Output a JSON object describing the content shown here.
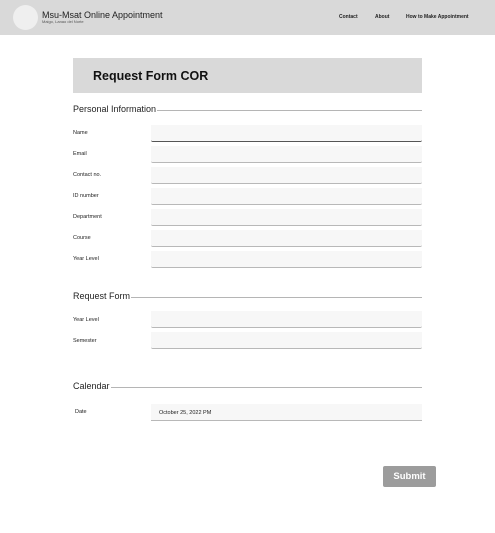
{
  "header": {
    "brand_title": "Msu-Msat Online Appointment",
    "brand_subtitle": "Maigo, Lanao del Norte",
    "logo_icon": "circle-logo",
    "nav": [
      {
        "label": "Contact"
      },
      {
        "label": "About"
      },
      {
        "label": "How to Make Appointment"
      }
    ]
  },
  "form": {
    "title": "Request Form COR",
    "sections": {
      "personal": {
        "title": "Personal Information",
        "fields": [
          {
            "label": "Name",
            "value": ""
          },
          {
            "label": "Email",
            "value": ""
          },
          {
            "label": "Contact no.",
            "value": ""
          },
          {
            "label": "ID number",
            "value": ""
          },
          {
            "label": "Department",
            "value": ""
          },
          {
            "label": "Course",
            "value": ""
          },
          {
            "label": "Year Level",
            "value": ""
          }
        ]
      },
      "request": {
        "title": "Request Form",
        "fields": [
          {
            "label": "Year Level",
            "value": ""
          },
          {
            "label": "Semester",
            "value": ""
          }
        ]
      },
      "calendar": {
        "title": "Calendar",
        "date_label": "Date",
        "date_value": "October 25, 2022 PM"
      }
    },
    "submit_label": "Submit"
  },
  "colors": {
    "topbar": "#d9d9d9",
    "title_box": "#d9d9d9",
    "submit": "#9c9c9c"
  }
}
